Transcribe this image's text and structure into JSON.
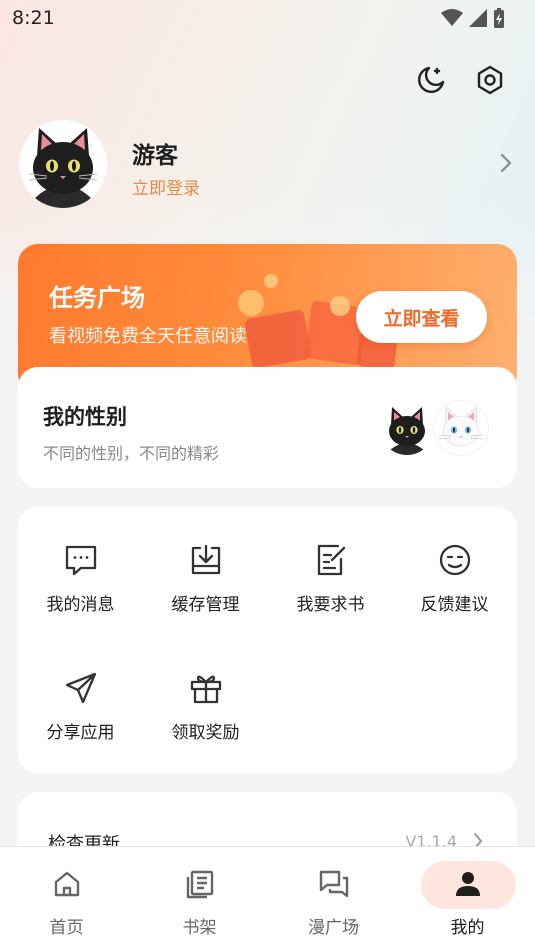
{
  "status_bar": {
    "time": "8:21"
  },
  "profile": {
    "name": "游客",
    "login_text": "立即登录"
  },
  "task_card": {
    "title": "任务广场",
    "subtitle": "看视频免费全天任意阅读",
    "button_label": "立即查看"
  },
  "gender_card": {
    "title": "我的性别",
    "subtitle": "不同的性别，不同的精彩"
  },
  "menu": {
    "items": [
      {
        "label": "我的消息",
        "icon": "message-icon"
      },
      {
        "label": "缓存管理",
        "icon": "download-tray-icon"
      },
      {
        "label": "我要求书",
        "icon": "edit-document-icon"
      },
      {
        "label": "反馈建议",
        "icon": "face-icon"
      },
      {
        "label": "分享应用",
        "icon": "send-icon"
      },
      {
        "label": "领取奖励",
        "icon": "gift-icon"
      }
    ]
  },
  "update": {
    "label": "检查更新",
    "version": "V1.1.4"
  },
  "bottom_nav": {
    "items": [
      {
        "label": "首页",
        "icon": "home-icon"
      },
      {
        "label": "书架",
        "icon": "bookshelf-icon"
      },
      {
        "label": "漫广场",
        "icon": "chat-square-icon"
      },
      {
        "label": "我的",
        "icon": "person-icon",
        "active": true
      }
    ]
  },
  "colors": {
    "accent": "#ff7a2e",
    "login_orange": "#e78a4c",
    "nav_active_pill": "#fde6de"
  }
}
